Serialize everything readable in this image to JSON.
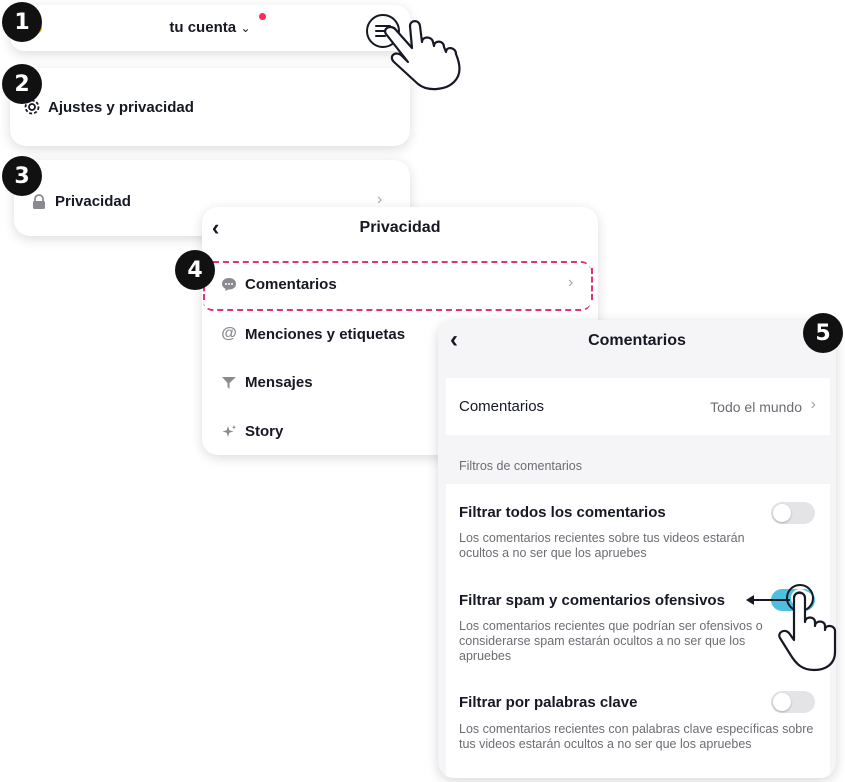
{
  "steps": [
    "1",
    "2",
    "3",
    "4",
    "5"
  ],
  "step1": {
    "title": "tu cuenta"
  },
  "step2": {
    "settings_label": "Ajustes y privacidad"
  },
  "step3": {
    "privacy_label": "Privacidad"
  },
  "privacy_screen": {
    "title": "Privacidad",
    "items": [
      {
        "label": "Comentarios",
        "icon": "comment-icon"
      },
      {
        "label": "Menciones y etiquetas",
        "icon": "at-icon"
      },
      {
        "label": "Mensajes",
        "icon": "message-icon"
      },
      {
        "label": "Story",
        "icon": "sparkle-icon"
      }
    ]
  },
  "comments_screen": {
    "title": "Comentarios",
    "who_label": "Comentarios",
    "who_value": "Todo el mundo",
    "filters_heading": "Filtros de comentarios",
    "filters": [
      {
        "label": "Filtrar todos los comentarios",
        "description": "Los comentarios recientes sobre tus videos estarán ocultos a no ser que los apruebes",
        "enabled": false
      },
      {
        "label": "Filtrar spam y comentarios ofensivos",
        "description": "Los comentarios recientes que podrían ser ofensivos o considerarse spam estarán ocultos a no ser que los apruebes",
        "enabled": true
      },
      {
        "label": "Filtrar por palabras clave",
        "description": "Los comentarios recientes con palabras clave específicas sobre tus videos estarán ocultos a no ser que los apruebes",
        "enabled": false
      }
    ]
  },
  "colors": {
    "notification_dot": "#fe2c55",
    "highlight_border": "#e8306a",
    "toggle_on": "#4ec0df",
    "toggle_off": "#e4e4e6"
  }
}
